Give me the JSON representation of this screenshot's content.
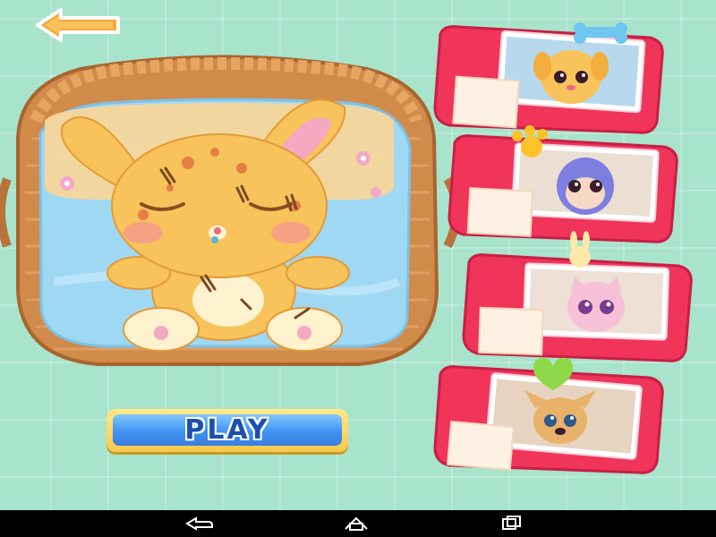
{
  "game": {
    "play_label": "PLAY",
    "selected_pet": "bunny"
  },
  "pets": [
    {
      "name": "puppy",
      "topper": "bone-icon"
    },
    {
      "name": "monkey",
      "topper": "paw-icon"
    },
    {
      "name": "kitten",
      "topper": "bunny-face-icon"
    },
    {
      "name": "chihuahua",
      "topper": "heart-icon"
    }
  ],
  "colors": {
    "background": "#a8e3cc",
    "card_frame": "#f0345a",
    "play_fill": "#3f93f0",
    "play_border": "#f7c94a",
    "basket": "#d08a4a",
    "blanket": "#a8dcf5",
    "bunny": "#f8c35a"
  },
  "nav": {
    "icons": [
      "nav-back-icon",
      "nav-home-icon",
      "nav-recents-icon"
    ]
  }
}
